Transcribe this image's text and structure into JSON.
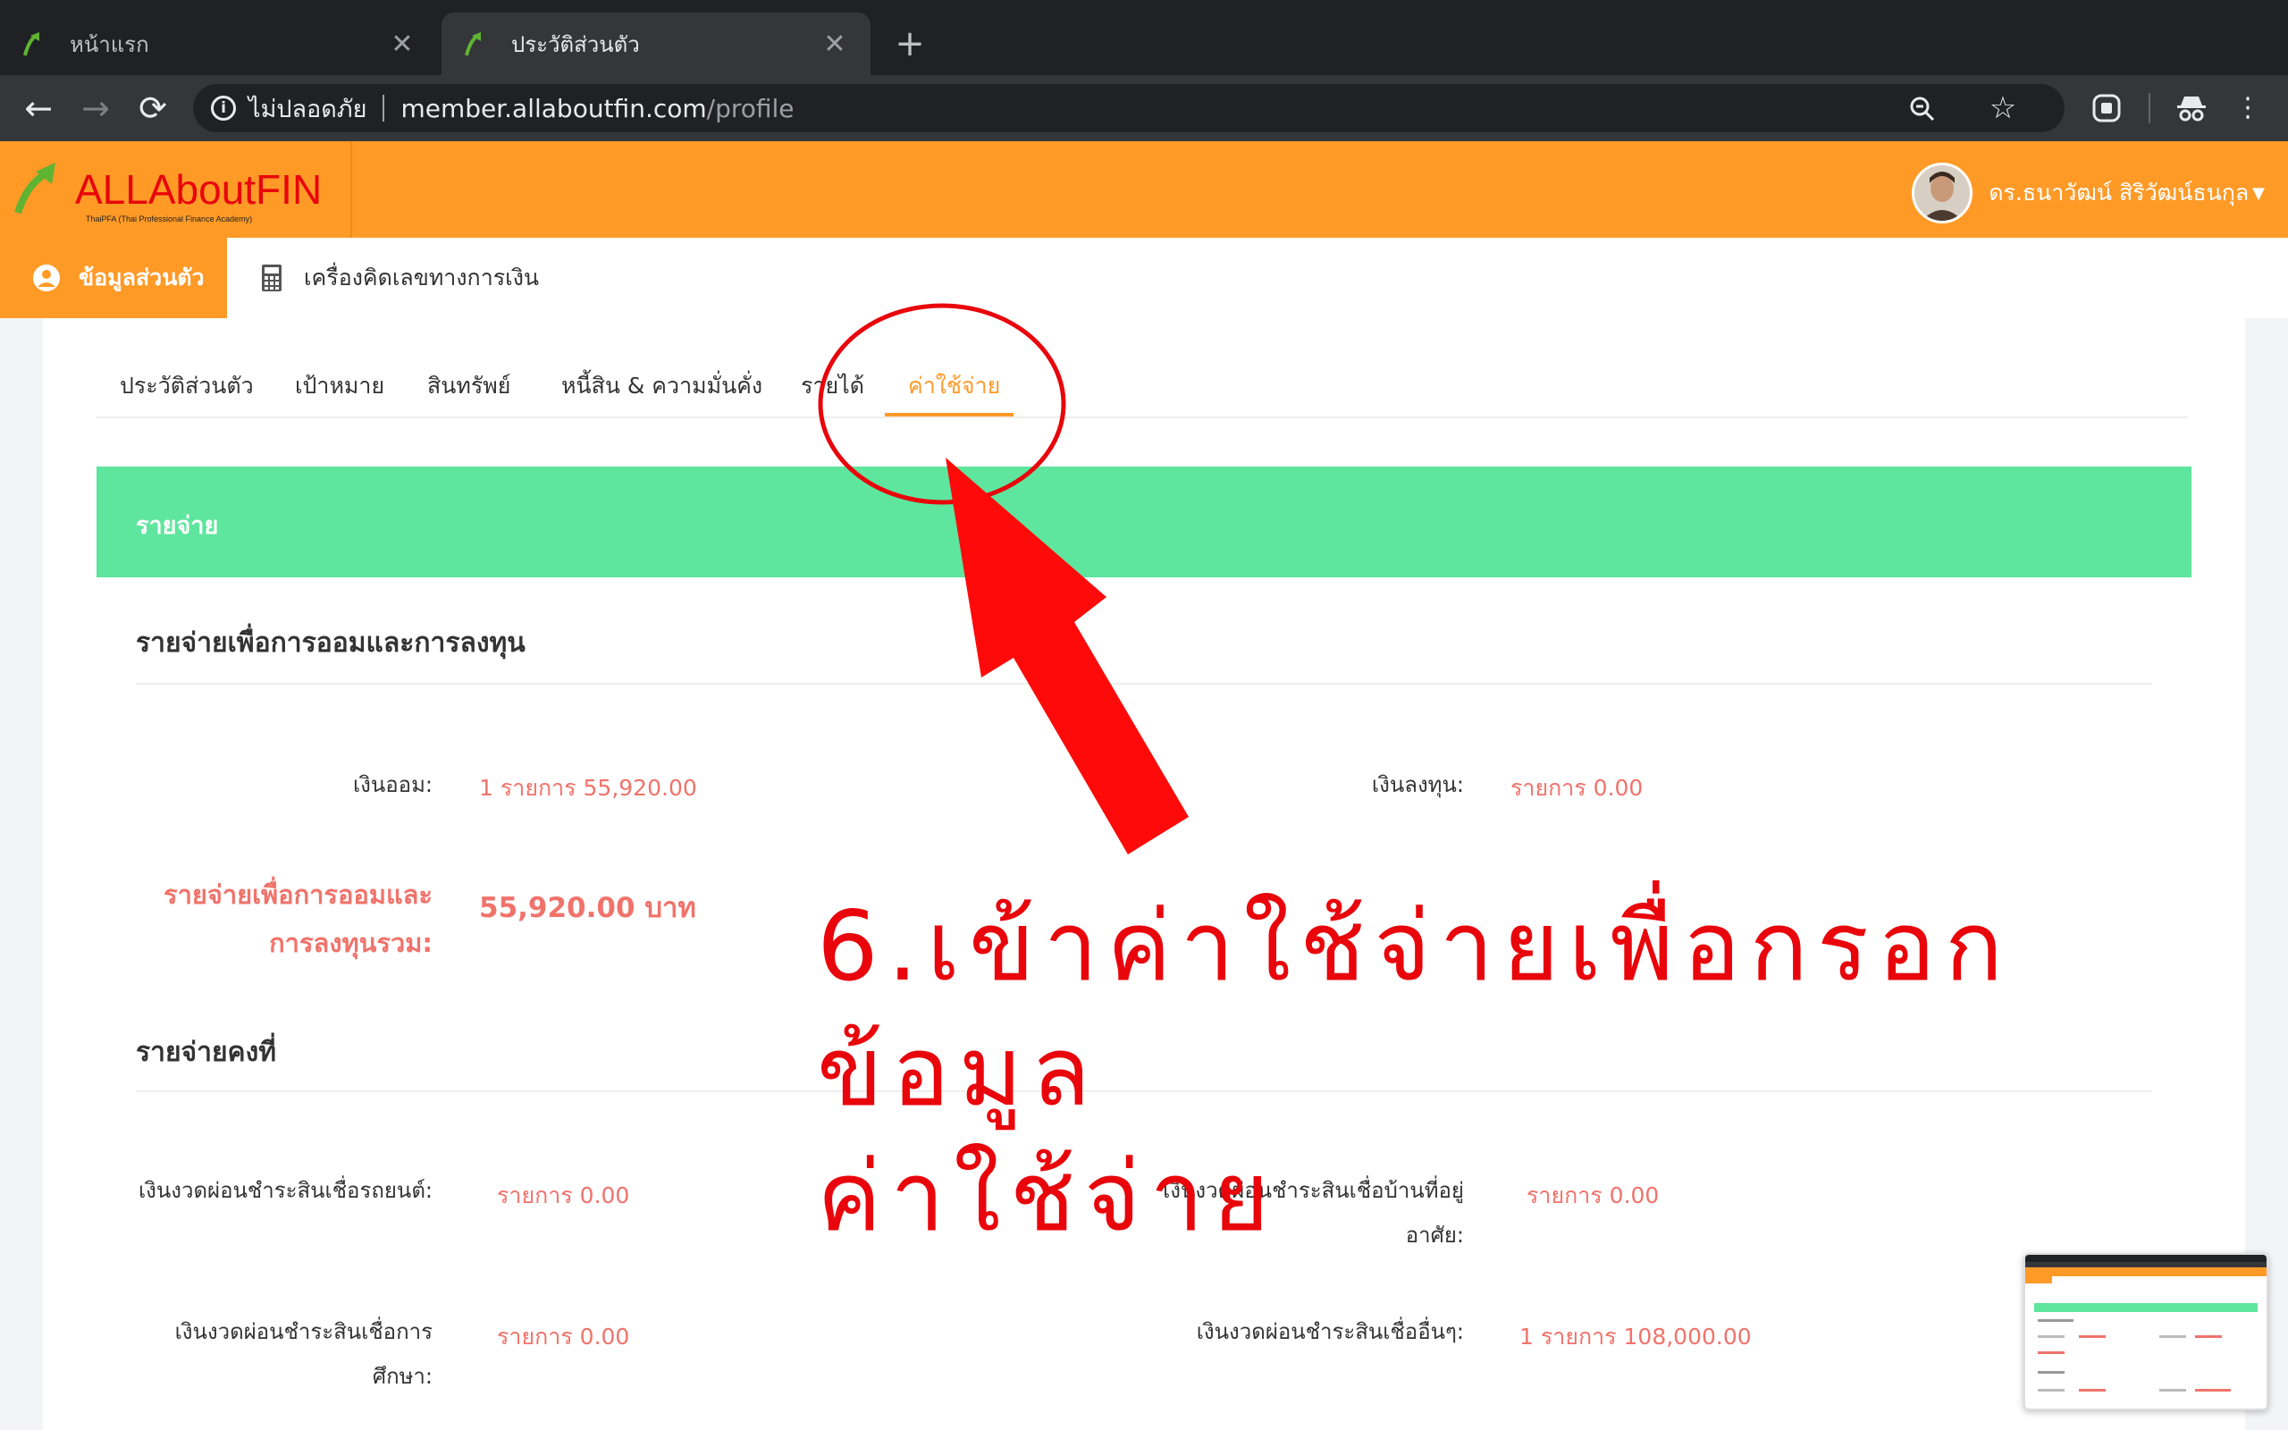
{
  "browser": {
    "tabs": [
      {
        "title": "หน้าแรก",
        "active": false
      },
      {
        "title": "ประวัติส่วนตัว",
        "active": true
      }
    ],
    "security_label": "ไม่ปลอดภัย",
    "url_host": "member.allaboutfin.com",
    "url_path": "/profile"
  },
  "header": {
    "logo_text": "ALLAboutFIN",
    "logo_tagline": "ThaiPFA (Thai Professional Finance Academy)",
    "user_name": "ดร.ธนาวัฒน์ สิริวัฒน์ธนกุล"
  },
  "subnav": {
    "profile_label": "ข้อมูลส่วนตัว",
    "calculator_label": "เครื่องคิดเลขทางการเงิน"
  },
  "profile_tabs": [
    {
      "label": "ประวัติส่วนตัว",
      "active": false
    },
    {
      "label": "เป้าหมาย",
      "active": false
    },
    {
      "label": "สินทรัพย์",
      "active": false
    },
    {
      "label": "หนี้สิน & ความมั่นคั่ง",
      "active": false
    },
    {
      "label": "รายได้",
      "active": false
    },
    {
      "label": "ค่าใช้จ่าย",
      "active": true
    }
  ],
  "banner_title": "รายจ่าย",
  "saving_section": {
    "title": "รายจ่ายเพื่อการออมและการลงทุน",
    "saving_label": "เงินออม:",
    "saving_value": "1 รายการ 55,920.00",
    "invest_label": "เงินลงทุน:",
    "invest_value": "รายการ 0.00",
    "total_label_line1": "รายจ่ายเพื่อการออมและ",
    "total_label_line2": "การลงทุนรวม:",
    "total_value": "55,920.00 บาท"
  },
  "fixed_section": {
    "title": "รายจ่ายคงที่",
    "car_label": "เงินงวดผ่อนชำระสินเชื่อรถยนต์:",
    "car_value": "รายการ 0.00",
    "home_label_line1": "เงินงวดผ่อนชำระสินเชื่อบ้านที่อยู่",
    "home_label_line2": "อาศัย:",
    "home_value": "รายการ 0.00",
    "edu_label_line1": "เงินงวดผ่อนชำระสินเชื่อการ",
    "edu_label_line2": "ศึกษา:",
    "edu_value": "รายการ 0.00",
    "other_label": "เงินงวดผ่อนชำระสินเชื่ออื่นๆ:",
    "other_value": "1 รายการ 108,000.00"
  },
  "annotation": {
    "line1": "6.เข้าค่าใช้จ่ายเพื่อกรอกข้อมูล",
    "line2": "ค่าใช้จ่าย"
  },
  "colors": {
    "brand_orange": "#ff9a27",
    "banner_green": "#5ee59e",
    "value_red": "#f0736b",
    "annotation_red": "#e8050b"
  }
}
